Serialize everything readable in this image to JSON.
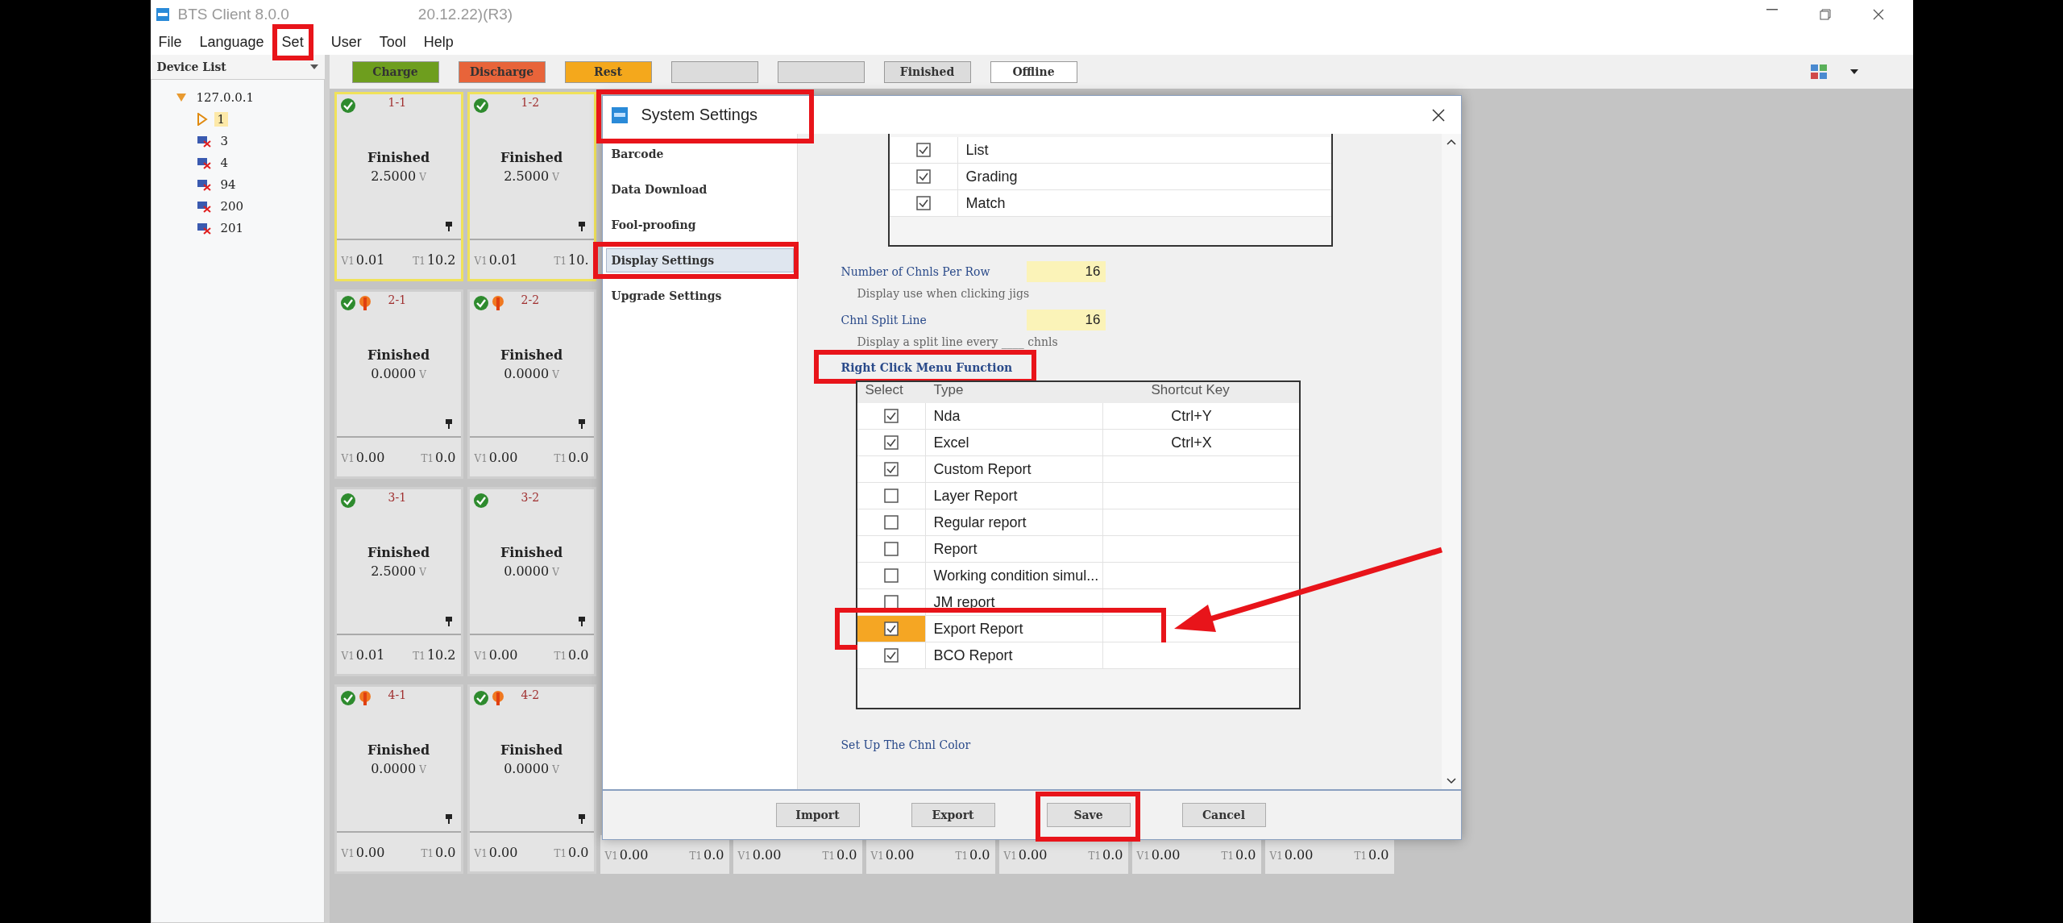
{
  "window": {
    "title_parts": [
      "BTS Client 8.0.0",
      "20.12.22)(R3)"
    ]
  },
  "menu": [
    {
      "label": "File",
      "highlighted": false
    },
    {
      "label": "Language",
      "highlighted": false
    },
    {
      "label": "Set",
      "highlighted": true
    },
    {
      "label": "User",
      "highlighted": false
    },
    {
      "label": "Tool",
      "highlighted": false
    },
    {
      "label": "Help",
      "highlighted": false
    }
  ],
  "device_list": {
    "title": "Device List",
    "tree": [
      {
        "label": "127.0.0.1",
        "expanded": true,
        "children": [
          {
            "label": "1",
            "online": true,
            "selected": true
          },
          {
            "label": "3",
            "online": false,
            "selected": false
          },
          {
            "label": "4",
            "online": false,
            "selected": false
          },
          {
            "label": "94",
            "online": false,
            "selected": false
          },
          {
            "label": "200",
            "online": false,
            "selected": false
          },
          {
            "label": "201",
            "online": false,
            "selected": false
          }
        ]
      }
    ]
  },
  "legend": [
    {
      "label": "Charge",
      "color": "#6e9e1e"
    },
    {
      "label": "Discharge",
      "color": "#e8643a"
    },
    {
      "label": "Rest",
      "color": "#f4a81c"
    },
    {
      "color": "#dcdcdc"
    },
    {
      "color": "#dcdcdc"
    },
    {
      "label": "Finished",
      "color": "#dcdcdc"
    },
    {
      "label": "Offline",
      "color": "#ffffff"
    }
  ],
  "channels": [
    [
      {
        "kind": "card",
        "label": "1-1",
        "status": "Finished",
        "voltage": "2.5000",
        "unit": "V",
        "v_label": "V1",
        "v": "0.01",
        "t_label": "T1",
        "t": "10.2",
        "selected": true,
        "flag": false
      },
      {
        "kind": "card",
        "label": "1-2",
        "status": "Finished",
        "voltage": "2.5000",
        "unit": "V",
        "v_label": "V1",
        "v": "0.01",
        "t_label": "T1",
        "t": "10.",
        "selected": true,
        "flag": false
      }
    ],
    [
      {
        "kind": "card",
        "label": "2-1",
        "status": "Finished",
        "voltage": "0.0000",
        "unit": "V",
        "v_label": "V1",
        "v": "0.00",
        "t_label": "T1",
        "t": "0.0",
        "selected": false,
        "flag": true
      },
      {
        "kind": "card",
        "label": "2-2",
        "status": "Finished",
        "voltage": "0.0000",
        "unit": "V",
        "v_label": "V1",
        "v": "0.00",
        "t_label": "T1",
        "t": "0.0",
        "selected": false,
        "flag": true
      }
    ],
    [
      {
        "kind": "card",
        "label": "3-1",
        "status": "Finished",
        "voltage": "2.5000",
        "unit": "V",
        "v_label": "V1",
        "v": "0.01",
        "t_label": "T1",
        "t": "10.2",
        "selected": false,
        "flag": false
      },
      {
        "kind": "card",
        "label": "3-2",
        "status": "Finished",
        "voltage": "0.0000",
        "unit": "V",
        "v_label": "V1",
        "v": "0.00",
        "t_label": "T1",
        "t": "0.0",
        "selected": false,
        "flag": false
      }
    ],
    [
      {
        "kind": "card",
        "label": "4-1",
        "status": "Finished",
        "voltage": "0.0000",
        "unit": "V",
        "v_label": "V1",
        "v": "0.00",
        "t_label": "T1",
        "t": "0.0",
        "selected": false,
        "flag": true
      },
      {
        "kind": "card",
        "label": "4-2",
        "status": "Finished",
        "voltage": "0.0000",
        "unit": "V",
        "v_label": "V1",
        "v": "0.00",
        "t_label": "T1",
        "t": "0.0",
        "selected": false,
        "flag": true
      },
      {
        "kind": "footer",
        "v_label": "V1",
        "v": "0.00",
        "t_label": "T1",
        "t": "0.0"
      },
      {
        "kind": "footer",
        "v_label": "V1",
        "v": "0.00",
        "t_label": "T1",
        "t": "0.0"
      },
      {
        "kind": "footer",
        "v_label": "V1",
        "v": "0.00",
        "t_label": "T1",
        "t": "0.0"
      },
      {
        "kind": "footer",
        "v_label": "V1",
        "v": "0.00",
        "t_label": "T1",
        "t": "0.0"
      },
      {
        "kind": "footer",
        "v_label": "V1",
        "v": "0.00",
        "t_label": "T1",
        "t": "0.0"
      },
      {
        "kind": "footer",
        "v_label": "V1",
        "v": "0.00",
        "t_label": "T1",
        "t": "0.0"
      }
    ]
  ],
  "dialog": {
    "title": "System Settings",
    "highlighted": true,
    "nav": [
      {
        "label": "Barcode",
        "selected": false,
        "highlighted": false
      },
      {
        "label": "Data Download",
        "selected": false,
        "highlighted": false
      },
      {
        "label": "Fool-proofing",
        "selected": false,
        "highlighted": false
      },
      {
        "label": "Display Settings",
        "selected": true,
        "highlighted": true
      },
      {
        "label": "Upgrade Settings",
        "selected": false,
        "highlighted": false
      }
    ],
    "report_list": [
      {
        "label": "List",
        "checked": true
      },
      {
        "label": "Grading",
        "checked": true
      },
      {
        "label": "Match",
        "checked": true
      }
    ],
    "fields": [
      {
        "label": "Number of Chnls Per Row",
        "value": "16",
        "hint": "Display use when clicking jigs"
      },
      {
        "label": "Chnl Split Line",
        "value": "16",
        "hint": "Display a split line every ____ chnls"
      }
    ],
    "menu_section": {
      "title": "Right Click Menu Function",
      "highlighted": true
    },
    "columns": [
      "Select",
      "Type",
      "Shortcut Key"
    ],
    "rows": [
      {
        "type": "Nda",
        "shortcut": "Ctrl+Y",
        "checked": true,
        "highlighted": false,
        "arrow": false
      },
      {
        "type": "Excel",
        "shortcut": "Ctrl+X",
        "checked": true,
        "highlighted": false,
        "arrow": false
      },
      {
        "type": "Custom Report",
        "checked": true,
        "highlighted": false,
        "arrow": false
      },
      {
        "type": "Layer Report",
        "checked": false,
        "highlighted": false,
        "arrow": false
      },
      {
        "type": "Regular report",
        "checked": false,
        "highlighted": false,
        "arrow": false
      },
      {
        "type": "Report",
        "checked": false,
        "highlighted": false,
        "arrow": false
      },
      {
        "type": "Working condition simul...",
        "checked": false,
        "highlighted": false,
        "arrow": false
      },
      {
        "type": "JM report",
        "checked": false,
        "highlighted": false,
        "arrow": false
      },
      {
        "type": "Export Report",
        "checked": true,
        "highlighted": true,
        "arrow": true
      },
      {
        "type": "BCO Report",
        "checked": true,
        "highlighted": false,
        "arrow": false
      }
    ],
    "color_section": "Set Up The Chnl Color",
    "buttons": [
      {
        "label": "Import",
        "highlighted": false
      },
      {
        "label": "Export",
        "highlighted": false
      },
      {
        "label": "Save",
        "highlighted": true
      },
      {
        "label": "Cancel",
        "highlighted": false
      }
    ]
  }
}
